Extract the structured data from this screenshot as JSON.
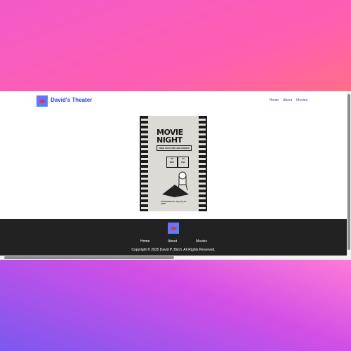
{
  "header": {
    "brand": "David's Theater",
    "nav": [
      "Home",
      "About",
      "Movies"
    ]
  },
  "poster": {
    "title_line1": "MOVIE",
    "title_line2": "NIGHT",
    "subtitle": "FREE POPCORN AND DRINKS",
    "date_day": "05",
    "date_month": "NOV",
    "time_value": "10",
    "time_unit": "P.M.",
    "address": "123 Anywhere St., Any City, ST 12345"
  },
  "footer": {
    "nav": [
      "Home",
      "About",
      "Movies"
    ],
    "copyright": "Copyright © 2025 David P. Birch. All Rights Reserved."
  },
  "colors": {
    "brand_text": "#2b3fd8",
    "footer_bg": "#222222",
    "logo_gradient_start": "#7b66ff",
    "logo_gradient_end": "#3f8cff"
  },
  "icons": {
    "logo": "lips-icon"
  }
}
